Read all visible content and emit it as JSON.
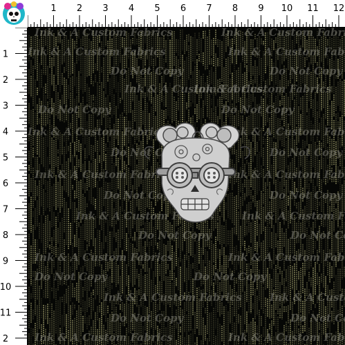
{
  "ruler": {
    "top_numbers": [
      "1",
      "2",
      "3",
      "4",
      "5",
      "6",
      "7",
      "8",
      "9",
      "10",
      "11",
      "12"
    ],
    "left_numbers": [
      "1",
      "2",
      "3",
      "4",
      "5",
      "6",
      "7",
      "8",
      "9",
      "10",
      "11",
      "2"
    ],
    "ruler_color": "#ffffff",
    "tick_color": "#000000"
  },
  "logo": {
    "name": "sugar-skull-logo-icon"
  },
  "fabric": {
    "background_color": "#060705",
    "streak_color": "#b8b67c",
    "watermark_color": "#9a9a90",
    "watermark_lines": [
      "Ink & A Custom Fabrics",
      "Do Not Copy"
    ]
  },
  "motif": {
    "name": "steampunk-skull-goggles-icon",
    "color": "#cfcfcf",
    "outline_color": "#4a4a4a"
  }
}
